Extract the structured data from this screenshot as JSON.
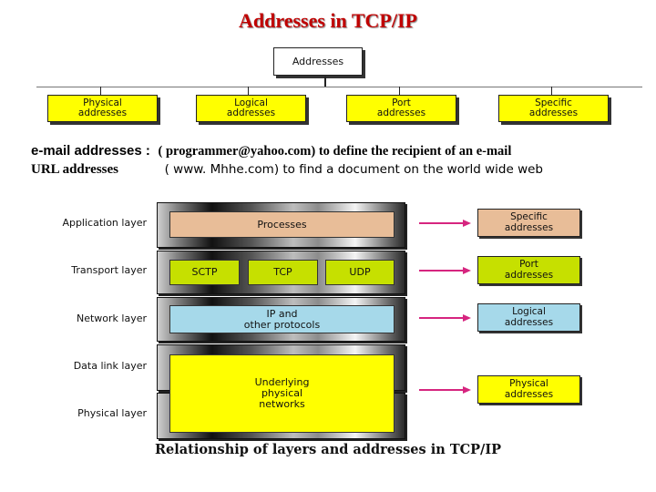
{
  "title": "Addresses in TCP/IP",
  "tree": {
    "root": "Addresses",
    "children": [
      {
        "line1": "Physical",
        "line2": "addresses"
      },
      {
        "line1": "Logical",
        "line2": "addresses"
      },
      {
        "line1": "Port",
        "line2": "addresses"
      },
      {
        "line1": "Specific",
        "line2": "addresses"
      }
    ]
  },
  "info": {
    "email_label": "e-mail addresses :",
    "email_text": "( programmer@yahoo.com) to define the recipient of an e-mail",
    "url_label": "URL addresses",
    "url_text": "( www. Mhhe.com) to find a document on the world wide web"
  },
  "layers": {
    "labels": [
      "Application layer",
      "Transport layer",
      "Network layer",
      "Data link layer",
      "Physical layer"
    ],
    "processes": "Processes",
    "transport_protocols": [
      "SCTP",
      "TCP",
      "UDP"
    ],
    "network_line1": "IP and",
    "network_line2": "other protocols",
    "physical_line1": "Underlying",
    "physical_line2": "physical",
    "physical_line3": "networks"
  },
  "address_boxes": [
    {
      "line1": "Specific",
      "line2": "addresses",
      "color": "#e8bd98"
    },
    {
      "line1": "Port",
      "line2": "addresses",
      "color": "#c6e000"
    },
    {
      "line1": "Logical",
      "line2": "addresses",
      "color": "#a6d9ea"
    },
    {
      "line1": "Physical",
      "line2": "addresses",
      "color": "#ffff00"
    }
  ],
  "colors": {
    "title": "#c00000",
    "arrow": "#d6257f",
    "processes": "#e8bd98",
    "transport": "#c6e000",
    "network": "#a6d9ea",
    "physical": "#ffff00"
  },
  "caption": "Relationship of layers and addresses in TCP/IP"
}
